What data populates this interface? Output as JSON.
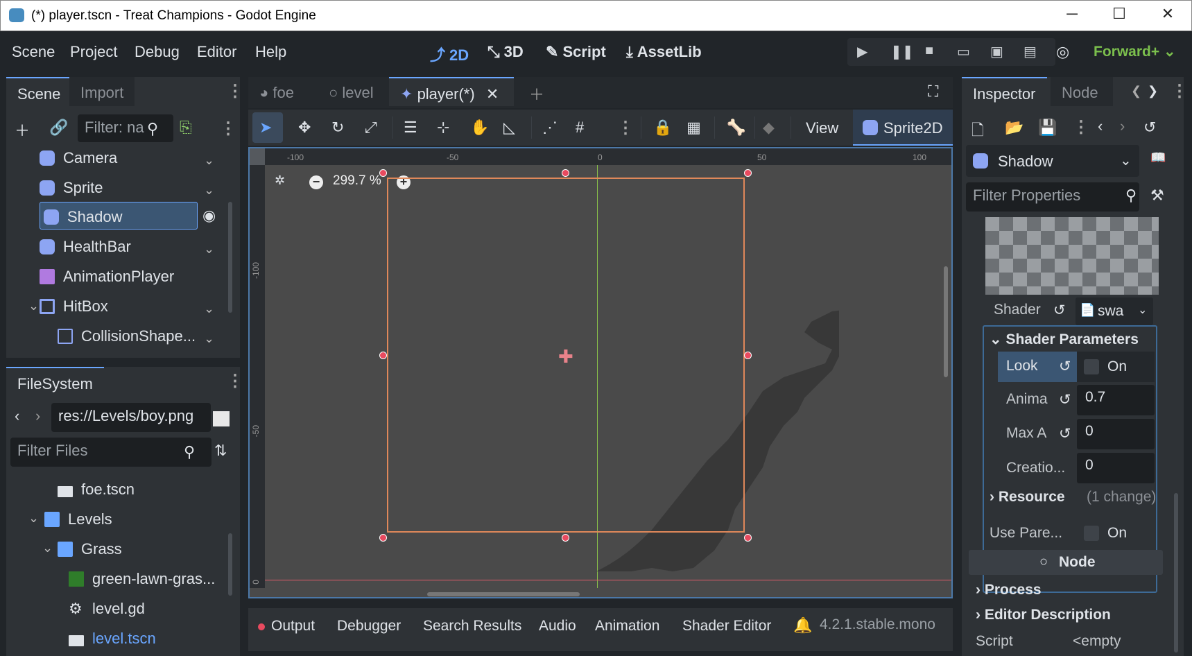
{
  "window": {
    "title": "(*) player.tscn - Treat Champions - Godot Engine",
    "minimize": "─",
    "maximize": "☐",
    "close": "✕"
  },
  "menu": {
    "items": [
      "Scene",
      "Project",
      "Debug",
      "Editor",
      "Help"
    ]
  },
  "workspaces": {
    "w2d": "2D",
    "w3d": "3D",
    "script": "Script",
    "assetlib": "AssetLib"
  },
  "renderer": "Forward+",
  "scene_dock": {
    "tab_scene": "Scene",
    "tab_import": "Import",
    "filter_placeholder": "Filter: na",
    "nodes": [
      {
        "label": "Camera"
      },
      {
        "label": "Sprite"
      },
      {
        "label": "Shadow"
      },
      {
        "label": "HealthBar"
      },
      {
        "label": "AnimationPlayer"
      },
      {
        "label": "HitBox"
      },
      {
        "label": "CollisionShape..."
      }
    ]
  },
  "filesystem": {
    "tab": "FileSystem",
    "path": "res://Levels/boy.png",
    "filter_placeholder": "Filter Files",
    "items": [
      {
        "label": "foe.tscn"
      },
      {
        "label": "Levels"
      },
      {
        "label": "Grass"
      },
      {
        "label": "green-lawn-gras..."
      },
      {
        "label": "level.gd"
      },
      {
        "label": "level.tscn"
      }
    ]
  },
  "editor_tabs": [
    {
      "label": "foe"
    },
    {
      "label": "level"
    },
    {
      "label": "player(*)"
    }
  ],
  "toolbar": {
    "view": "View",
    "sprite2d": "Sprite2D"
  },
  "viewport": {
    "zoom": "299.7 %",
    "ruler_h": [
      "-100",
      "-50",
      "0",
      "50",
      "100"
    ],
    "ruler_v": [
      "-100",
      "-50",
      "0"
    ]
  },
  "bottom": {
    "tabs": [
      "Output",
      "Debugger",
      "Search Results",
      "Audio",
      "Animation",
      "Shader Editor"
    ],
    "version": "4.2.1.stable.mono"
  },
  "inspector": {
    "tab_inspector": "Inspector",
    "tab_node": "Node",
    "object": "Shadow",
    "filter_placeholder": "Filter Properties",
    "shader_label": "Shader",
    "shader_value": "swa",
    "shader_params": "Shader Parameters",
    "params": [
      {
        "name": "Look",
        "value": "On"
      },
      {
        "name": "Anima",
        "value": "0.7"
      },
      {
        "name": "Max A",
        "value": "0"
      },
      {
        "name": "Creatio...",
        "value": "0"
      }
    ],
    "resource": "Resource",
    "resource_change": "(1 change)",
    "use_parent": "Use Pare...",
    "use_parent_value": "On",
    "node_section": "Node",
    "process": "Process",
    "editor_desc": "Editor Description",
    "script_label": "Script",
    "script_value": "<empty"
  }
}
